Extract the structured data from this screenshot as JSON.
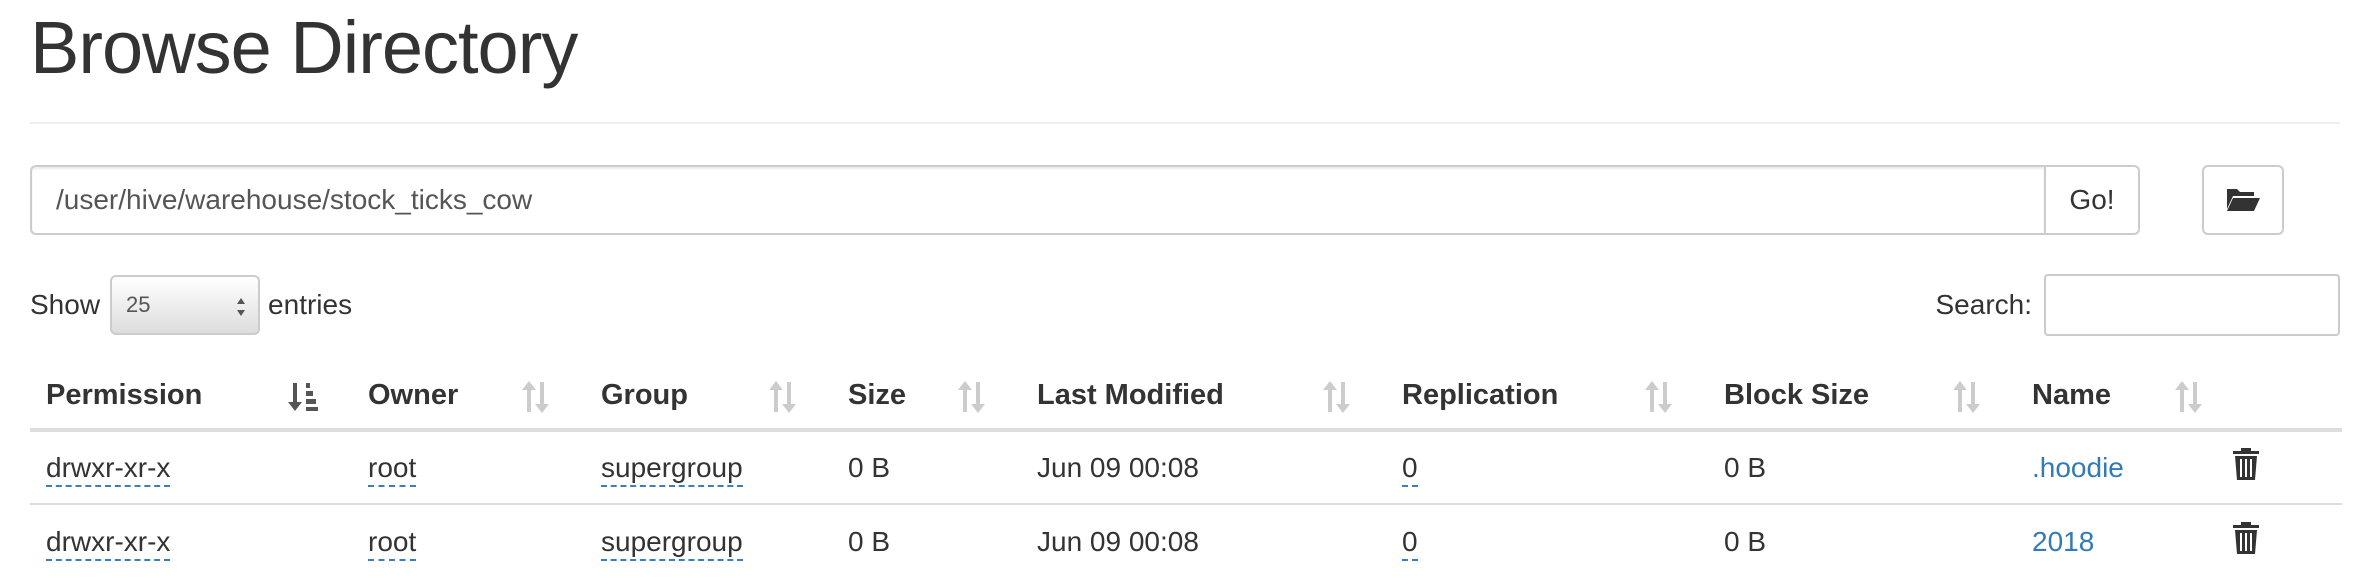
{
  "page": {
    "title": "Browse Directory"
  },
  "path_bar": {
    "path_value": "/user/hive/warehouse/stock_ticks_cow",
    "go_label": "Go!",
    "folder_icon": "folder-open-icon"
  },
  "length_control": {
    "show_label": "Show",
    "selected": "25",
    "entries_label": "entries"
  },
  "search": {
    "label": "Search:",
    "value": ""
  },
  "table": {
    "headers": [
      "Permission",
      "Owner",
      "Group",
      "Size",
      "Last Modified",
      "Replication",
      "Block Size",
      "Name"
    ],
    "sorted_column": "Permission",
    "rows": [
      {
        "permission": "drwxr-xr-x",
        "owner": "root",
        "group": "supergroup",
        "size": "0 B",
        "modified": "Jun 09 00:08",
        "replication": "0",
        "block_size": "0 B",
        "name": ".hoodie"
      },
      {
        "permission": "drwxr-xr-x",
        "owner": "root",
        "group": "supergroup",
        "size": "0 B",
        "modified": "Jun 09 00:08",
        "replication": "0",
        "block_size": "0 B",
        "name": "2018"
      }
    ]
  },
  "colors": {
    "link": "#337ab7",
    "text": "#333333",
    "border": "#dddddd"
  }
}
